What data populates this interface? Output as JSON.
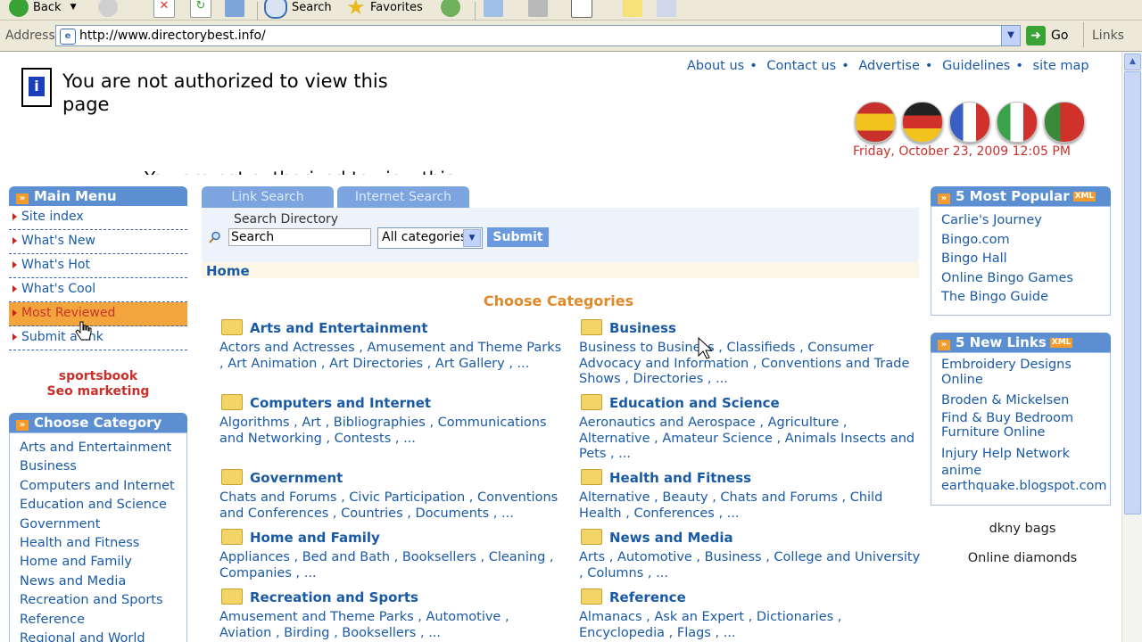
{
  "browser": {
    "back_label": "Back",
    "search_label": "Search",
    "favorites_label": "Favorites",
    "address_label": "Address",
    "url": "http://www.directorybest.info/",
    "go_label": "Go",
    "links_label": "Links"
  },
  "page": {
    "auth_message": "You are not authorized to view this page",
    "ghost_text": "You are not authorized to view this",
    "top_links": [
      "About us",
      "Contact us",
      "Advertise",
      "Guidelines",
      "site map"
    ],
    "datetime": "Friday, October 23, 2009 12:05 PM"
  },
  "left_menu": {
    "title": "Main Menu",
    "items": [
      "Site index",
      "What's New",
      "What's Hot",
      "What's Cool",
      "Most Reviewed",
      "Submit a link"
    ],
    "active_index": 4
  },
  "promo": [
    "sportsbook",
    "Seo marketing"
  ],
  "choose_category_box": {
    "title": "Choose Category",
    "items": [
      "Arts and Entertainment",
      "Business",
      "Computers and Internet",
      "Education and Science",
      "Government",
      "Health and Fitness",
      "Home and Family",
      "News and Media",
      "Recreation and Sports",
      "Reference",
      "Regional and World"
    ]
  },
  "search": {
    "tab_link": "Link Search",
    "tab_internet": "Internet Search",
    "label": "Search Directory",
    "input_value": "Search",
    "select_value": "All categories",
    "submit_label": "Submit"
  },
  "breadcrumb": "Home",
  "choose_title": "Choose Categories",
  "categories": [
    {
      "title": "Arts and Entertainment",
      "subs": "Actors and Actresses , Amusement and Theme Parks , Art Animation , Art Directories , Art Gallery , ..."
    },
    {
      "title": "Business",
      "subs": "Business to Business , Classifieds , Consumer Advocacy and Information , Conventions and Trade Shows , Directories , ..."
    },
    {
      "title": "Computers and Internet",
      "subs": "Algorithms , Art , Bibliographies , Communications and Networking , Contests , ..."
    },
    {
      "title": "Education and Science",
      "subs": "Aeronautics and Aerospace , Agriculture , Alternative , Amateur Science , Animals Insects and Pets , ..."
    },
    {
      "title": "Government",
      "subs": "Chats and Forums , Civic Participation , Conventions and Conferences , Countries , Documents , ..."
    },
    {
      "title": "Health and Fitness",
      "subs": "Alternative , Beauty , Chats and Forums , Child Health , Conferences , ..."
    },
    {
      "title": "Home and Family",
      "subs": "Appliances , Bed and Bath , Booksellers , Cleaning , Companies , ..."
    },
    {
      "title": "News and Media",
      "subs": "Arts , Automotive , Business , College and University , Columns , ..."
    },
    {
      "title": "Recreation and Sports",
      "subs": "Amusement and Theme Parks , Automotive , Aviation , Birding , Booksellers , ..."
    },
    {
      "title": "Reference",
      "subs": "Almanacs , Ask an Expert , Dictionaries , Encyclopedia , Flags , ..."
    }
  ],
  "popular": {
    "title": "5 Most Popular",
    "badge": "XML",
    "items": [
      "Carlie's Journey",
      "Bingo.com",
      "Bingo Hall",
      "Online Bingo Games",
      "The Bingo Guide"
    ]
  },
  "new_links": {
    "title": "5 New Links",
    "badge": "XML",
    "items": [
      "Embroidery Designs Online",
      "Broden & Mickelsen",
      "Find & Buy Bedroom Furniture Online",
      "Injury Help Network",
      "anime earthquake.blogspot.com"
    ]
  },
  "right_texts": [
    "dkny bags",
    "Online diamonds"
  ],
  "flag_colors": [
    "#e8a81c",
    "#222222",
    "#3a5fc4",
    "#3aa34a",
    "#d9402a"
  ]
}
